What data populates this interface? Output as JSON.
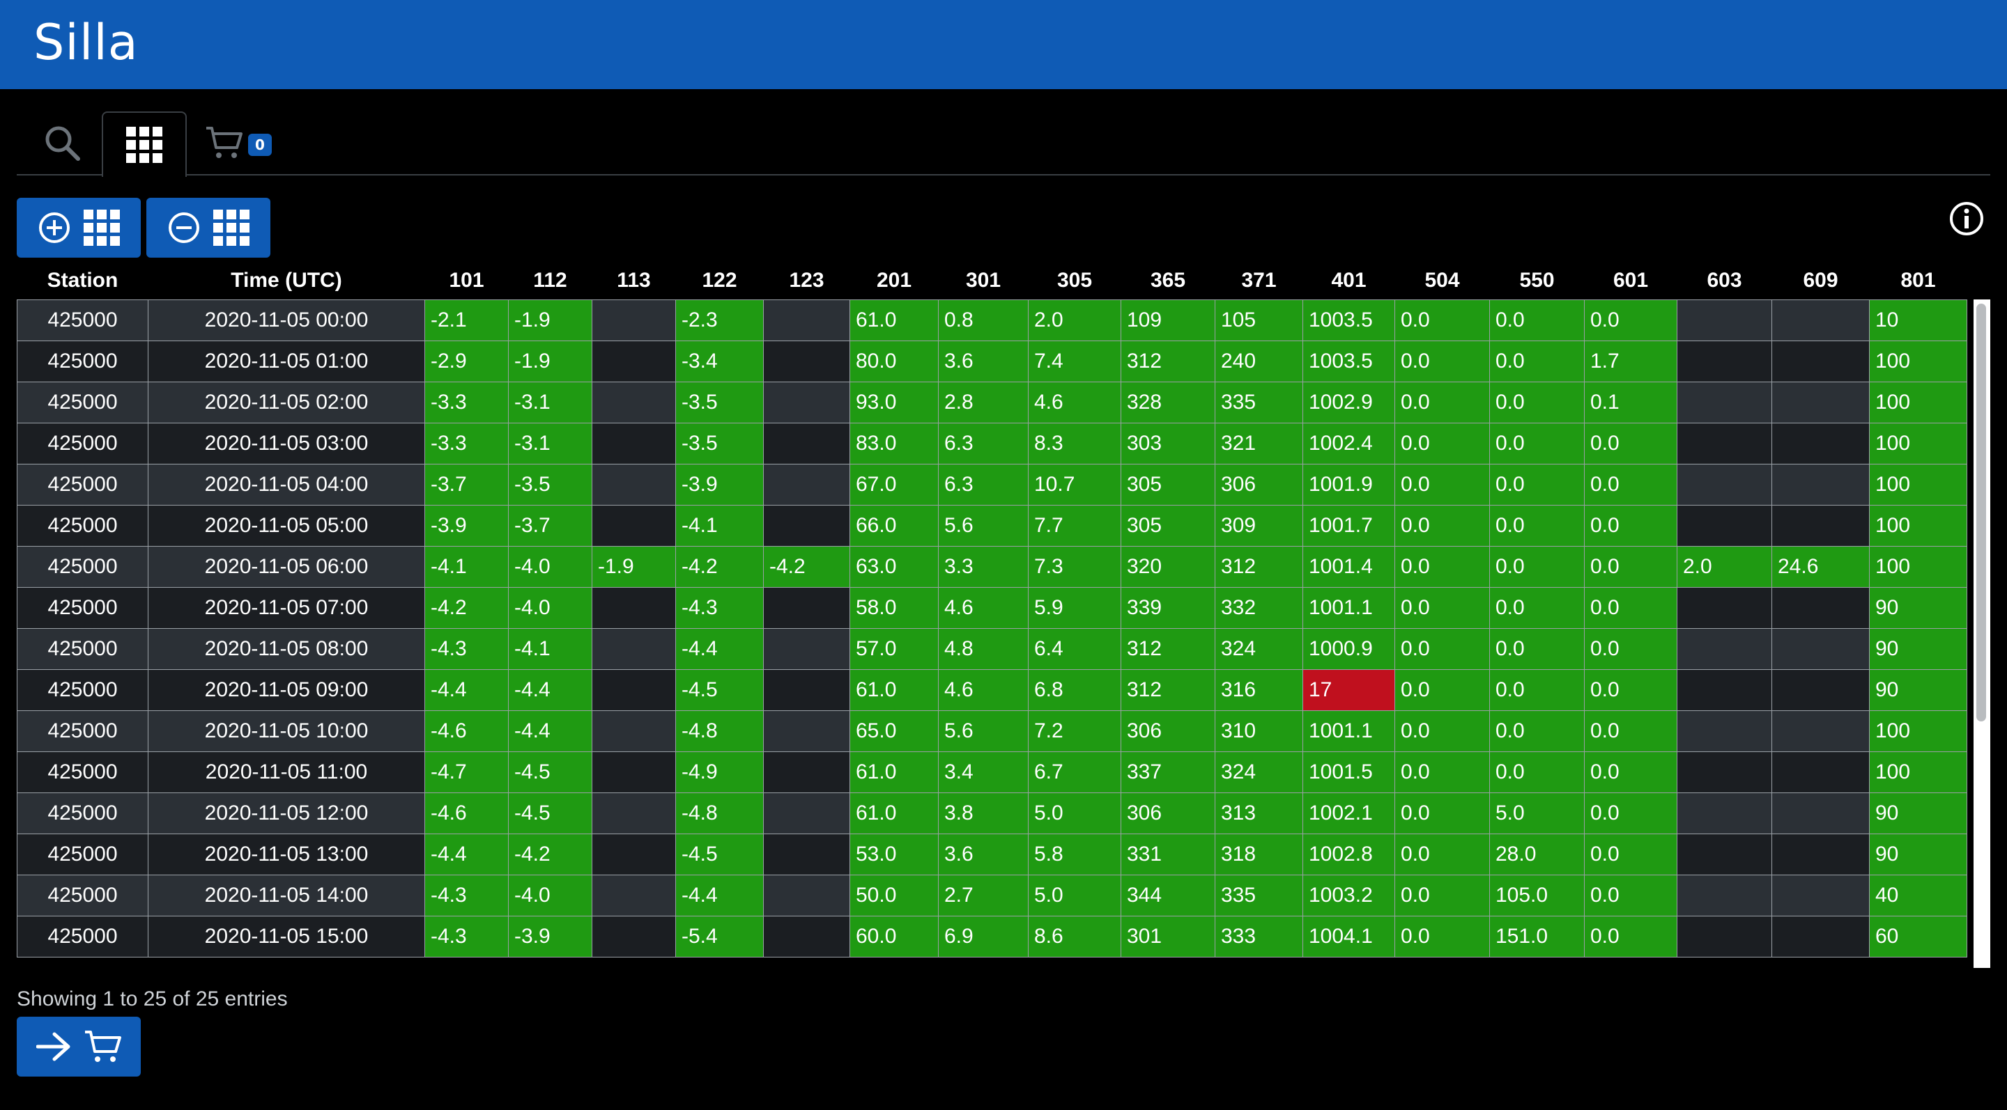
{
  "app": {
    "title": "Silla",
    "brand_color": "#0f5bb5"
  },
  "tabs": [
    {
      "icon": "search-icon"
    },
    {
      "icon": "grid-icon",
      "active": true
    },
    {
      "icon": "cart-icon",
      "badge": "0"
    }
  ],
  "toolbar": {
    "add_icon": "plus-circle-icon",
    "remove_icon": "minus-circle-icon",
    "grid_icon": "grid-icon",
    "info_icon": "info-icon"
  },
  "table": {
    "columns": [
      "Station",
      "Time (UTC)",
      "101",
      "112",
      "113",
      "122",
      "123",
      "201",
      "301",
      "305",
      "365",
      "371",
      "401",
      "504",
      "550",
      "601",
      "603",
      "609",
      "801"
    ],
    "rows": [
      [
        "425000",
        "2020-11-05 00:00",
        "-2.1",
        "-1.9",
        "",
        "-2.3",
        "",
        "61.0",
        "0.8",
        "2.0",
        "109",
        "105",
        "1003.5",
        "0.0",
        "0.0",
        "0.0",
        "",
        "",
        "10"
      ],
      [
        "425000",
        "2020-11-05 01:00",
        "-2.9",
        "-1.9",
        "",
        "-3.4",
        "",
        "80.0",
        "3.6",
        "7.4",
        "312",
        "240",
        "1003.5",
        "0.0",
        "0.0",
        "1.7",
        "",
        "",
        "100"
      ],
      [
        "425000",
        "2020-11-05 02:00",
        "-3.3",
        "-3.1",
        "",
        "-3.5",
        "",
        "93.0",
        "2.8",
        "4.6",
        "328",
        "335",
        "1002.9",
        "0.0",
        "0.0",
        "0.1",
        "",
        "",
        "100"
      ],
      [
        "425000",
        "2020-11-05 03:00",
        "-3.3",
        "-3.1",
        "",
        "-3.5",
        "",
        "83.0",
        "6.3",
        "8.3",
        "303",
        "321",
        "1002.4",
        "0.0",
        "0.0",
        "0.0",
        "",
        "",
        "100"
      ],
      [
        "425000",
        "2020-11-05 04:00",
        "-3.7",
        "-3.5",
        "",
        "-3.9",
        "",
        "67.0",
        "6.3",
        "10.7",
        "305",
        "306",
        "1001.9",
        "0.0",
        "0.0",
        "0.0",
        "",
        "",
        "100"
      ],
      [
        "425000",
        "2020-11-05 05:00",
        "-3.9",
        "-3.7",
        "",
        "-4.1",
        "",
        "66.0",
        "5.6",
        "7.7",
        "305",
        "309",
        "1001.7",
        "0.0",
        "0.0",
        "0.0",
        "",
        "",
        "100"
      ],
      [
        "425000",
        "2020-11-05 06:00",
        "-4.1",
        "-4.0",
        "-1.9",
        "-4.2",
        "-4.2",
        "63.0",
        "3.3",
        "7.3",
        "320",
        "312",
        "1001.4",
        "0.0",
        "0.0",
        "0.0",
        "2.0",
        "24.6",
        "100"
      ],
      [
        "425000",
        "2020-11-05 07:00",
        "-4.2",
        "-4.0",
        "",
        "-4.3",
        "",
        "58.0",
        "4.6",
        "5.9",
        "339",
        "332",
        "1001.1",
        "0.0",
        "0.0",
        "0.0",
        "",
        "",
        "90"
      ],
      [
        "425000",
        "2020-11-05 08:00",
        "-4.3",
        "-4.1",
        "",
        "-4.4",
        "",
        "57.0",
        "4.8",
        "6.4",
        "312",
        "324",
        "1000.9",
        "0.0",
        "0.0",
        "0.0",
        "",
        "",
        "90"
      ],
      [
        "425000",
        "2020-11-05 09:00",
        "-4.4",
        "-4.4",
        "",
        "-4.5",
        "",
        "61.0",
        "4.6",
        "6.8",
        "312",
        "316",
        "17",
        "0.0",
        "0.0",
        "0.0",
        "",
        "",
        "90"
      ],
      [
        "425000",
        "2020-11-05 10:00",
        "-4.6",
        "-4.4",
        "",
        "-4.8",
        "",
        "65.0",
        "5.6",
        "7.2",
        "306",
        "310",
        "1001.1",
        "0.0",
        "0.0",
        "0.0",
        "",
        "",
        "100"
      ],
      [
        "425000",
        "2020-11-05 11:00",
        "-4.7",
        "-4.5",
        "",
        "-4.9",
        "",
        "61.0",
        "3.4",
        "6.7",
        "337",
        "324",
        "1001.5",
        "0.0",
        "0.0",
        "0.0",
        "",
        "",
        "100"
      ],
      [
        "425000",
        "2020-11-05 12:00",
        "-4.6",
        "-4.5",
        "",
        "-4.8",
        "",
        "61.0",
        "3.8",
        "5.0",
        "306",
        "313",
        "1002.1",
        "0.0",
        "5.0",
        "0.0",
        "",
        "",
        "90"
      ],
      [
        "425000",
        "2020-11-05 13:00",
        "-4.4",
        "-4.2",
        "",
        "-4.5",
        "",
        "53.0",
        "3.6",
        "5.8",
        "331",
        "318",
        "1002.8",
        "0.0",
        "28.0",
        "0.0",
        "",
        "",
        "90"
      ],
      [
        "425000",
        "2020-11-05 14:00",
        "-4.3",
        "-4.0",
        "",
        "-4.4",
        "",
        "50.0",
        "2.7",
        "5.0",
        "344",
        "335",
        "1003.2",
        "0.0",
        "105.0",
        "0.0",
        "",
        "",
        "40"
      ],
      [
        "425000",
        "2020-11-05 15:00",
        "-4.3",
        "-3.9",
        "",
        "-5.4",
        "",
        "60.0",
        "6.9",
        "8.6",
        "301",
        "333",
        "1004.1",
        "0.0",
        "151.0",
        "0.0",
        "",
        "",
        "60"
      ]
    ],
    "flagged_cells": [
      {
        "row": 9,
        "col": 12,
        "status": "error"
      }
    ],
    "status_colors": {
      "ok": "#1f9a12",
      "error": "#c0101e"
    }
  },
  "footer": {
    "info": "Showing 1 to 25 of 25 entries",
    "cart_button_icons": [
      "arrow-right-icon",
      "cart-icon"
    ]
  }
}
